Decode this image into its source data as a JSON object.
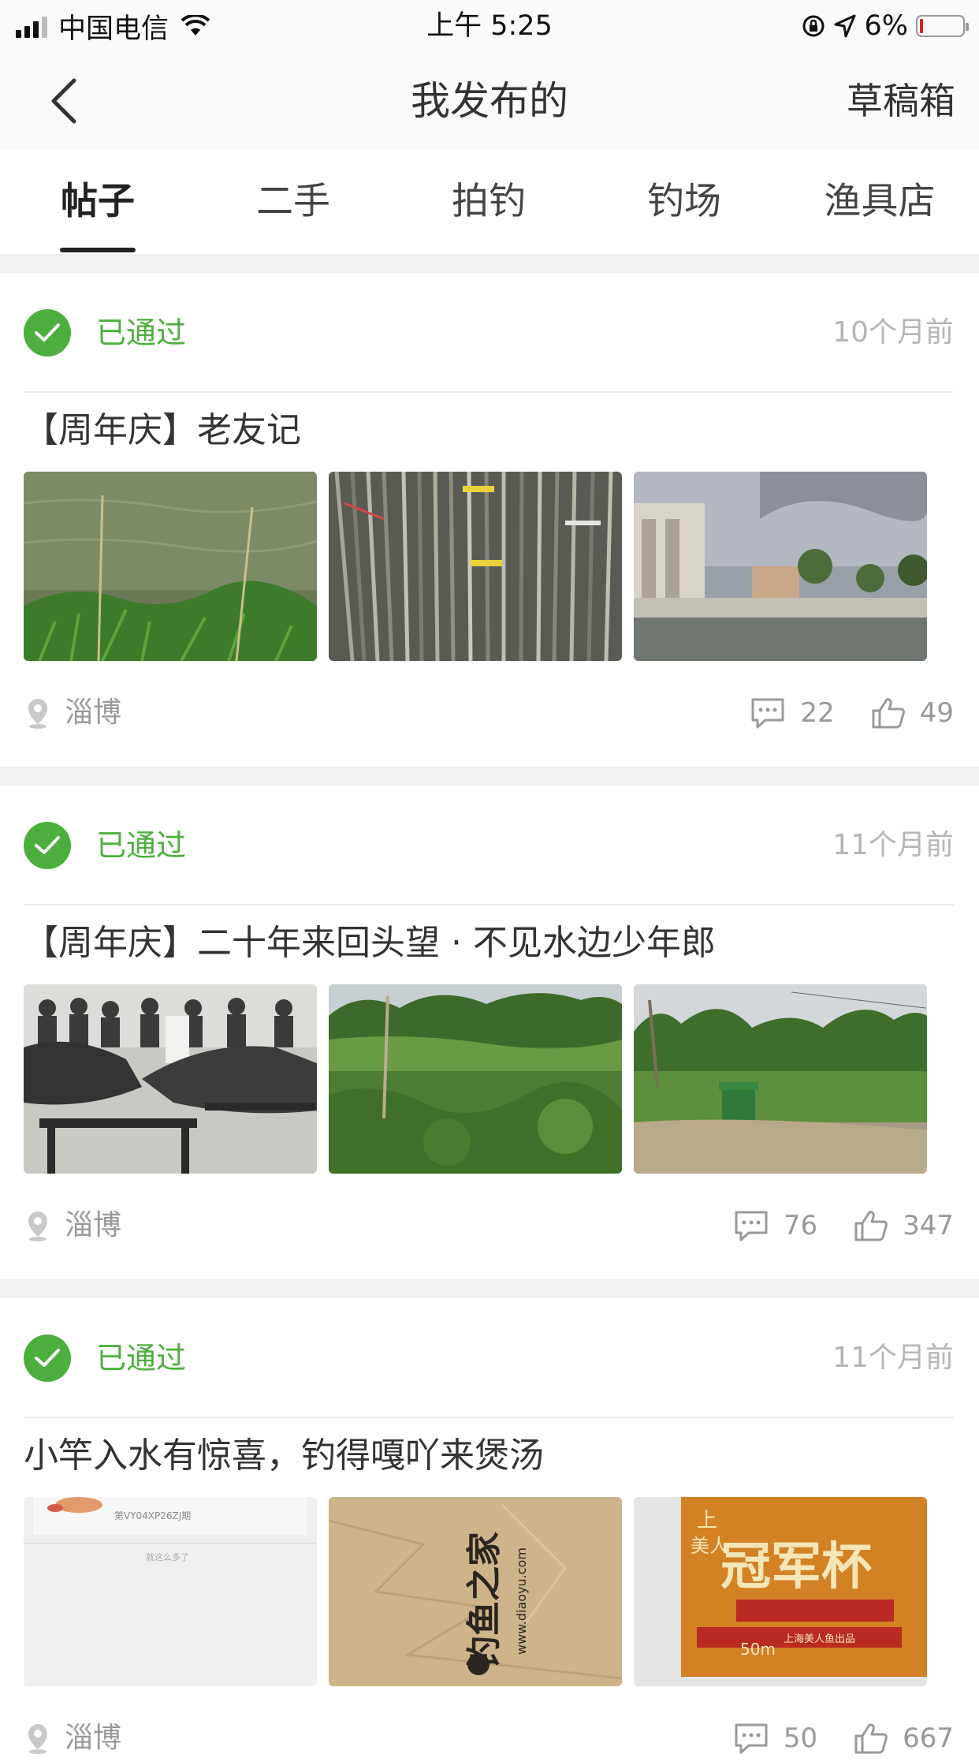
{
  "status_bar": {
    "carrier": "中国电信",
    "time": "上午 5:25",
    "battery": "6%"
  },
  "nav": {
    "title": "我发布的",
    "right_action": "草稿箱"
  },
  "tabs": [
    {
      "label": "帖子",
      "active": true
    },
    {
      "label": "二手",
      "active": false
    },
    {
      "label": "拍钓",
      "active": false
    },
    {
      "label": "钓场",
      "active": false
    },
    {
      "label": "渔具店",
      "active": false
    }
  ],
  "posts": [
    {
      "status": "已通过",
      "time": "10个月前",
      "title": "【周年庆】老友记",
      "location": "淄博",
      "comments": "22",
      "likes": "49"
    },
    {
      "status": "已通过",
      "time": "11个月前",
      "title": "【周年庆】二十年来回头望 · 不见水边少年郎",
      "location": "淄博",
      "comments": "76",
      "likes": "347"
    },
    {
      "status": "已通过",
      "time": "11个月前",
      "title": "小竿入水有惊喜，钓得嘎吖来煲汤",
      "location": "淄博",
      "comments": "50",
      "likes": "667"
    }
  ],
  "thumb_texts": {
    "screenshot_line1": "第VY04XP26ZJ期",
    "screenshot_line2": "就这么多了",
    "bag_brand": "钓鱼之家",
    "bag_url": "www.diaoyu.com",
    "box_brand": "冠军杯",
    "box_maker": "上海美人鱼出品",
    "box_length": "50m"
  },
  "colors": {
    "accent_green": "#4caf3d",
    "gray_text": "#999999",
    "divider": "#ececec"
  }
}
